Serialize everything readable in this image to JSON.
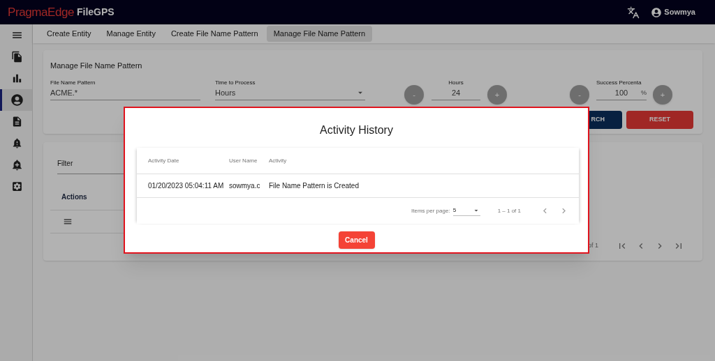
{
  "header": {
    "brand_logo": "PragmaEdge",
    "app_name": "FileGPS",
    "user": "Sowmya"
  },
  "sidebar": {
    "items": [
      {
        "kind": "menu",
        "selected": false
      },
      {
        "kind": "files",
        "selected": false
      },
      {
        "kind": "chart",
        "selected": false
      },
      {
        "kind": "account",
        "selected": true
      },
      {
        "kind": "document",
        "selected": false
      },
      {
        "kind": "alert",
        "selected": false
      },
      {
        "kind": "add-alert",
        "selected": false
      },
      {
        "kind": "settings",
        "selected": false
      }
    ]
  },
  "tabs": [
    {
      "label": "Create Entity",
      "selected": false
    },
    {
      "label": "Manage Entity",
      "selected": false
    },
    {
      "label": "Create File Name Pattern",
      "selected": false
    },
    {
      "label": "Manage File Name Pattern",
      "selected": true
    }
  ],
  "form": {
    "title": "Manage File Name Pattern",
    "file_name_pattern": {
      "label": "File Name Pattern",
      "value": "ACME.*"
    },
    "time_to_process": {
      "label": "Time to Process",
      "value": "Hours"
    },
    "hours": {
      "label": "Hours",
      "value": "24",
      "minus": "-",
      "plus": "+"
    },
    "success": {
      "label": "Success Percenta",
      "value": "100",
      "unit": "%",
      "minus": "-",
      "plus": "+"
    },
    "search_button": "RCH",
    "reset_button": "RESET"
  },
  "list": {
    "filter_label": "Filter",
    "actions_header": "Actions",
    "pagination_range": "of 1"
  },
  "dialog": {
    "title": "Activity History",
    "columns": [
      "Activity Date",
      "User Name",
      "Activity"
    ],
    "rows": [
      [
        "01/20/2023 05:04:11 AM",
        "sowmya.c",
        "File Name Pattern is Created"
      ]
    ],
    "items_per_page_label": "Items per page:",
    "items_per_page": "5",
    "range": "1 – 1 of 1",
    "cancel_button": "Cancel"
  }
}
